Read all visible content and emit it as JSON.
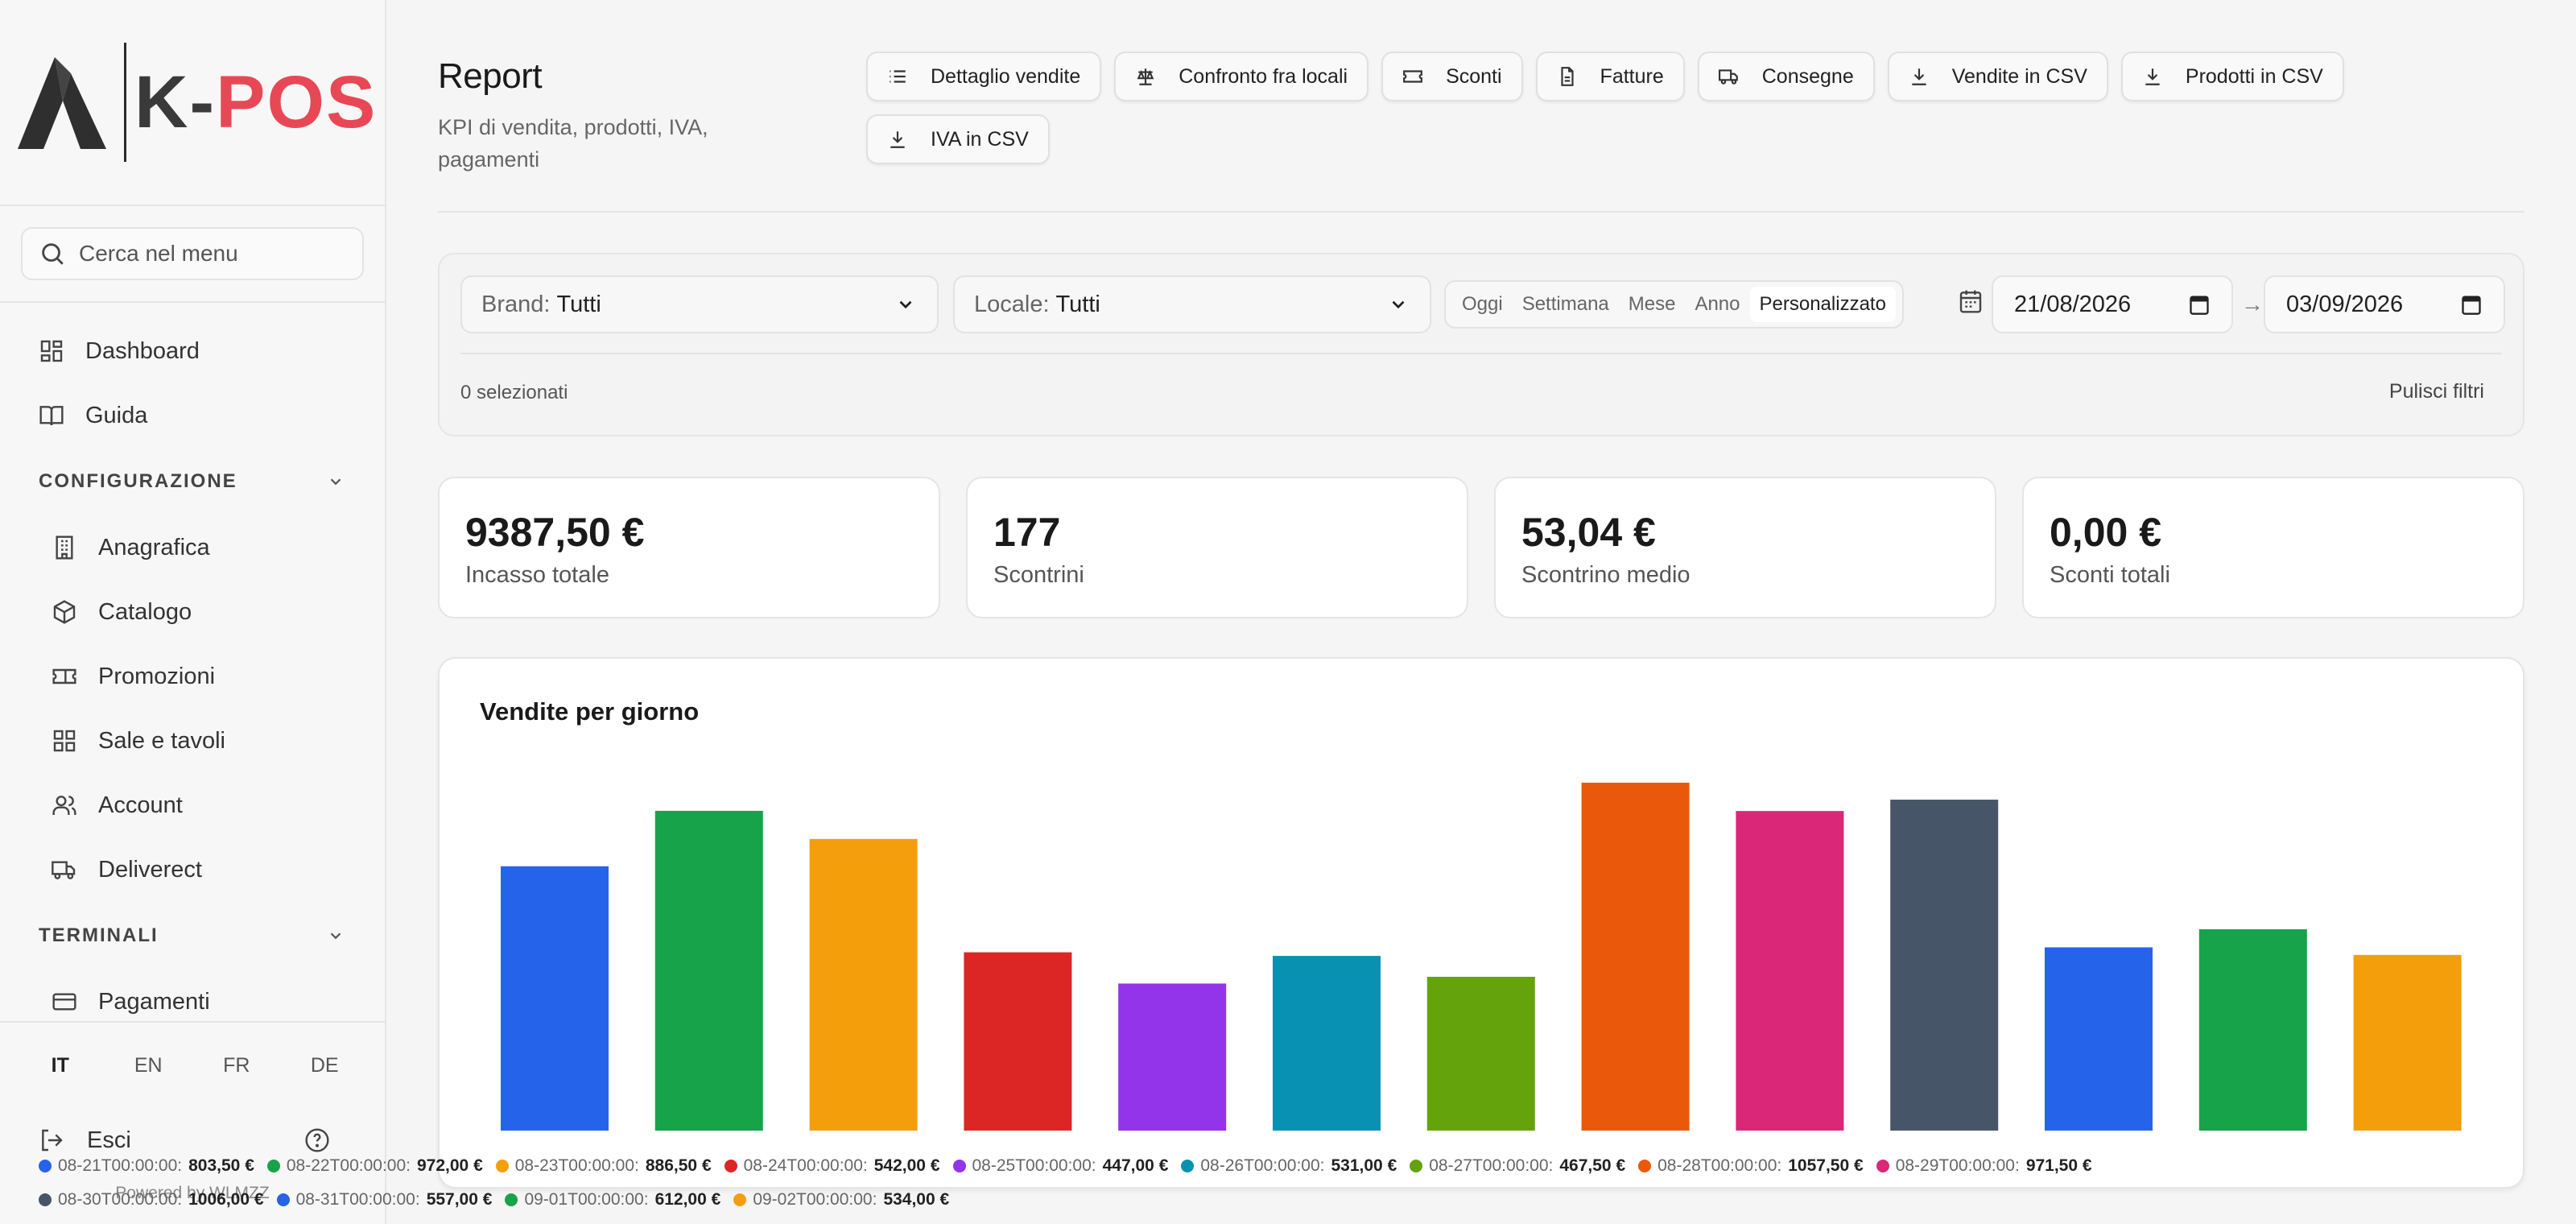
{
  "brand": {
    "k": "K",
    "dash": "-",
    "pos": "POS"
  },
  "sidebar": {
    "search_placeholder": "Cerca nel menu",
    "items": [
      {
        "label": "Dashboard",
        "icon": "dashboard-icon"
      },
      {
        "label": "Guida",
        "icon": "book-icon"
      }
    ],
    "sections": [
      {
        "label": "CONFIGURAZIONE",
        "items": [
          {
            "label": "Anagrafica",
            "icon": "building-icon"
          },
          {
            "label": "Catalogo",
            "icon": "package-icon"
          },
          {
            "label": "Promozioni",
            "icon": "ticket-icon"
          },
          {
            "label": "Sale e tavoli",
            "icon": "grid-icon"
          },
          {
            "label": "Account",
            "icon": "users-icon"
          },
          {
            "label": "Deliverect",
            "icon": "truck-icon"
          }
        ]
      },
      {
        "label": "TERMINALI",
        "items": [
          {
            "label": "Pagamenti",
            "icon": "credit-card-icon"
          }
        ]
      }
    ],
    "languages": [
      "IT",
      "EN",
      "FR",
      "DE"
    ],
    "active_language": "IT",
    "logout": "Esci",
    "powered": "Powered by WLMZZ"
  },
  "header": {
    "title": "Report",
    "subtitle": "KPI di vendita, prodotti, IVA, pagamenti",
    "actions": [
      {
        "label": "Dettaglio vendite",
        "icon": "list-icon"
      },
      {
        "label": "Confronto fra locali",
        "icon": "scale-icon"
      },
      {
        "label": "Sconti",
        "icon": "ticket-icon"
      },
      {
        "label": "Fatture",
        "icon": "file-icon"
      },
      {
        "label": "Consegne",
        "icon": "truck-icon"
      },
      {
        "label": "Vendite in CSV",
        "icon": "download-icon"
      },
      {
        "label": "Prodotti in CSV",
        "icon": "download-icon"
      },
      {
        "label": "IVA in CSV",
        "icon": "download-icon"
      }
    ]
  },
  "filters": {
    "brand_label": "Brand:",
    "brand_value": "Tutti",
    "locale_label": "Locale:",
    "locale_value": "Tutti",
    "periods": [
      "Oggi",
      "Settimana",
      "Mese",
      "Anno",
      "Personalizzato"
    ],
    "active_period": "Personalizzato",
    "date_from": "21/08/2026",
    "date_to": "03/09/2026",
    "selected_count": "0 selezionati",
    "clear": "Pulisci filtri"
  },
  "kpis": [
    {
      "value": "9387,50 €",
      "label": "Incasso totale"
    },
    {
      "value": "177",
      "label": "Scontrini"
    },
    {
      "value": "53,04 €",
      "label": "Scontrino medio"
    },
    {
      "value": "0,00 €",
      "label": "Sconti totali"
    }
  ],
  "chart_data": {
    "type": "bar",
    "title": "Vendite per giorno",
    "categories": [
      "08-21T00:00:00:",
      "08-22T00:00:00:",
      "08-23T00:00:00:",
      "08-24T00:00:00:",
      "08-25T00:00:00:",
      "08-26T00:00:00:",
      "08-27T00:00:00:",
      "08-28T00:00:00:",
      "08-29T00:00:00:",
      "08-30T00:00:00:",
      "08-31T00:00:00:",
      "09-01T00:00:00:",
      "09-02T00:00:00:"
    ],
    "values": [
      803.5,
      972.0,
      886.5,
      542.0,
      447.0,
      531.0,
      467.5,
      1057.5,
      971.5,
      1006.0,
      557.0,
      612.0,
      534.0
    ],
    "value_labels": [
      "803,50 €",
      "972,00 €",
      "886,50 €",
      "542,00 €",
      "447,00 €",
      "531,00 €",
      "467,50 €",
      "1057,50 €",
      "971,50 €",
      "1006,00 €",
      "557,00 €",
      "612,00 €",
      "534,00 €"
    ],
    "colors": [
      "#2563eb",
      "#16a34a",
      "#f59e0b",
      "#dc2626",
      "#9333ea",
      "#0891b2",
      "#65a30d",
      "#ea580c",
      "#db2777",
      "#475569",
      "#2563eb",
      "#16a34a",
      "#f59e0b"
    ],
    "legend": "bottom",
    "grid": false
  }
}
